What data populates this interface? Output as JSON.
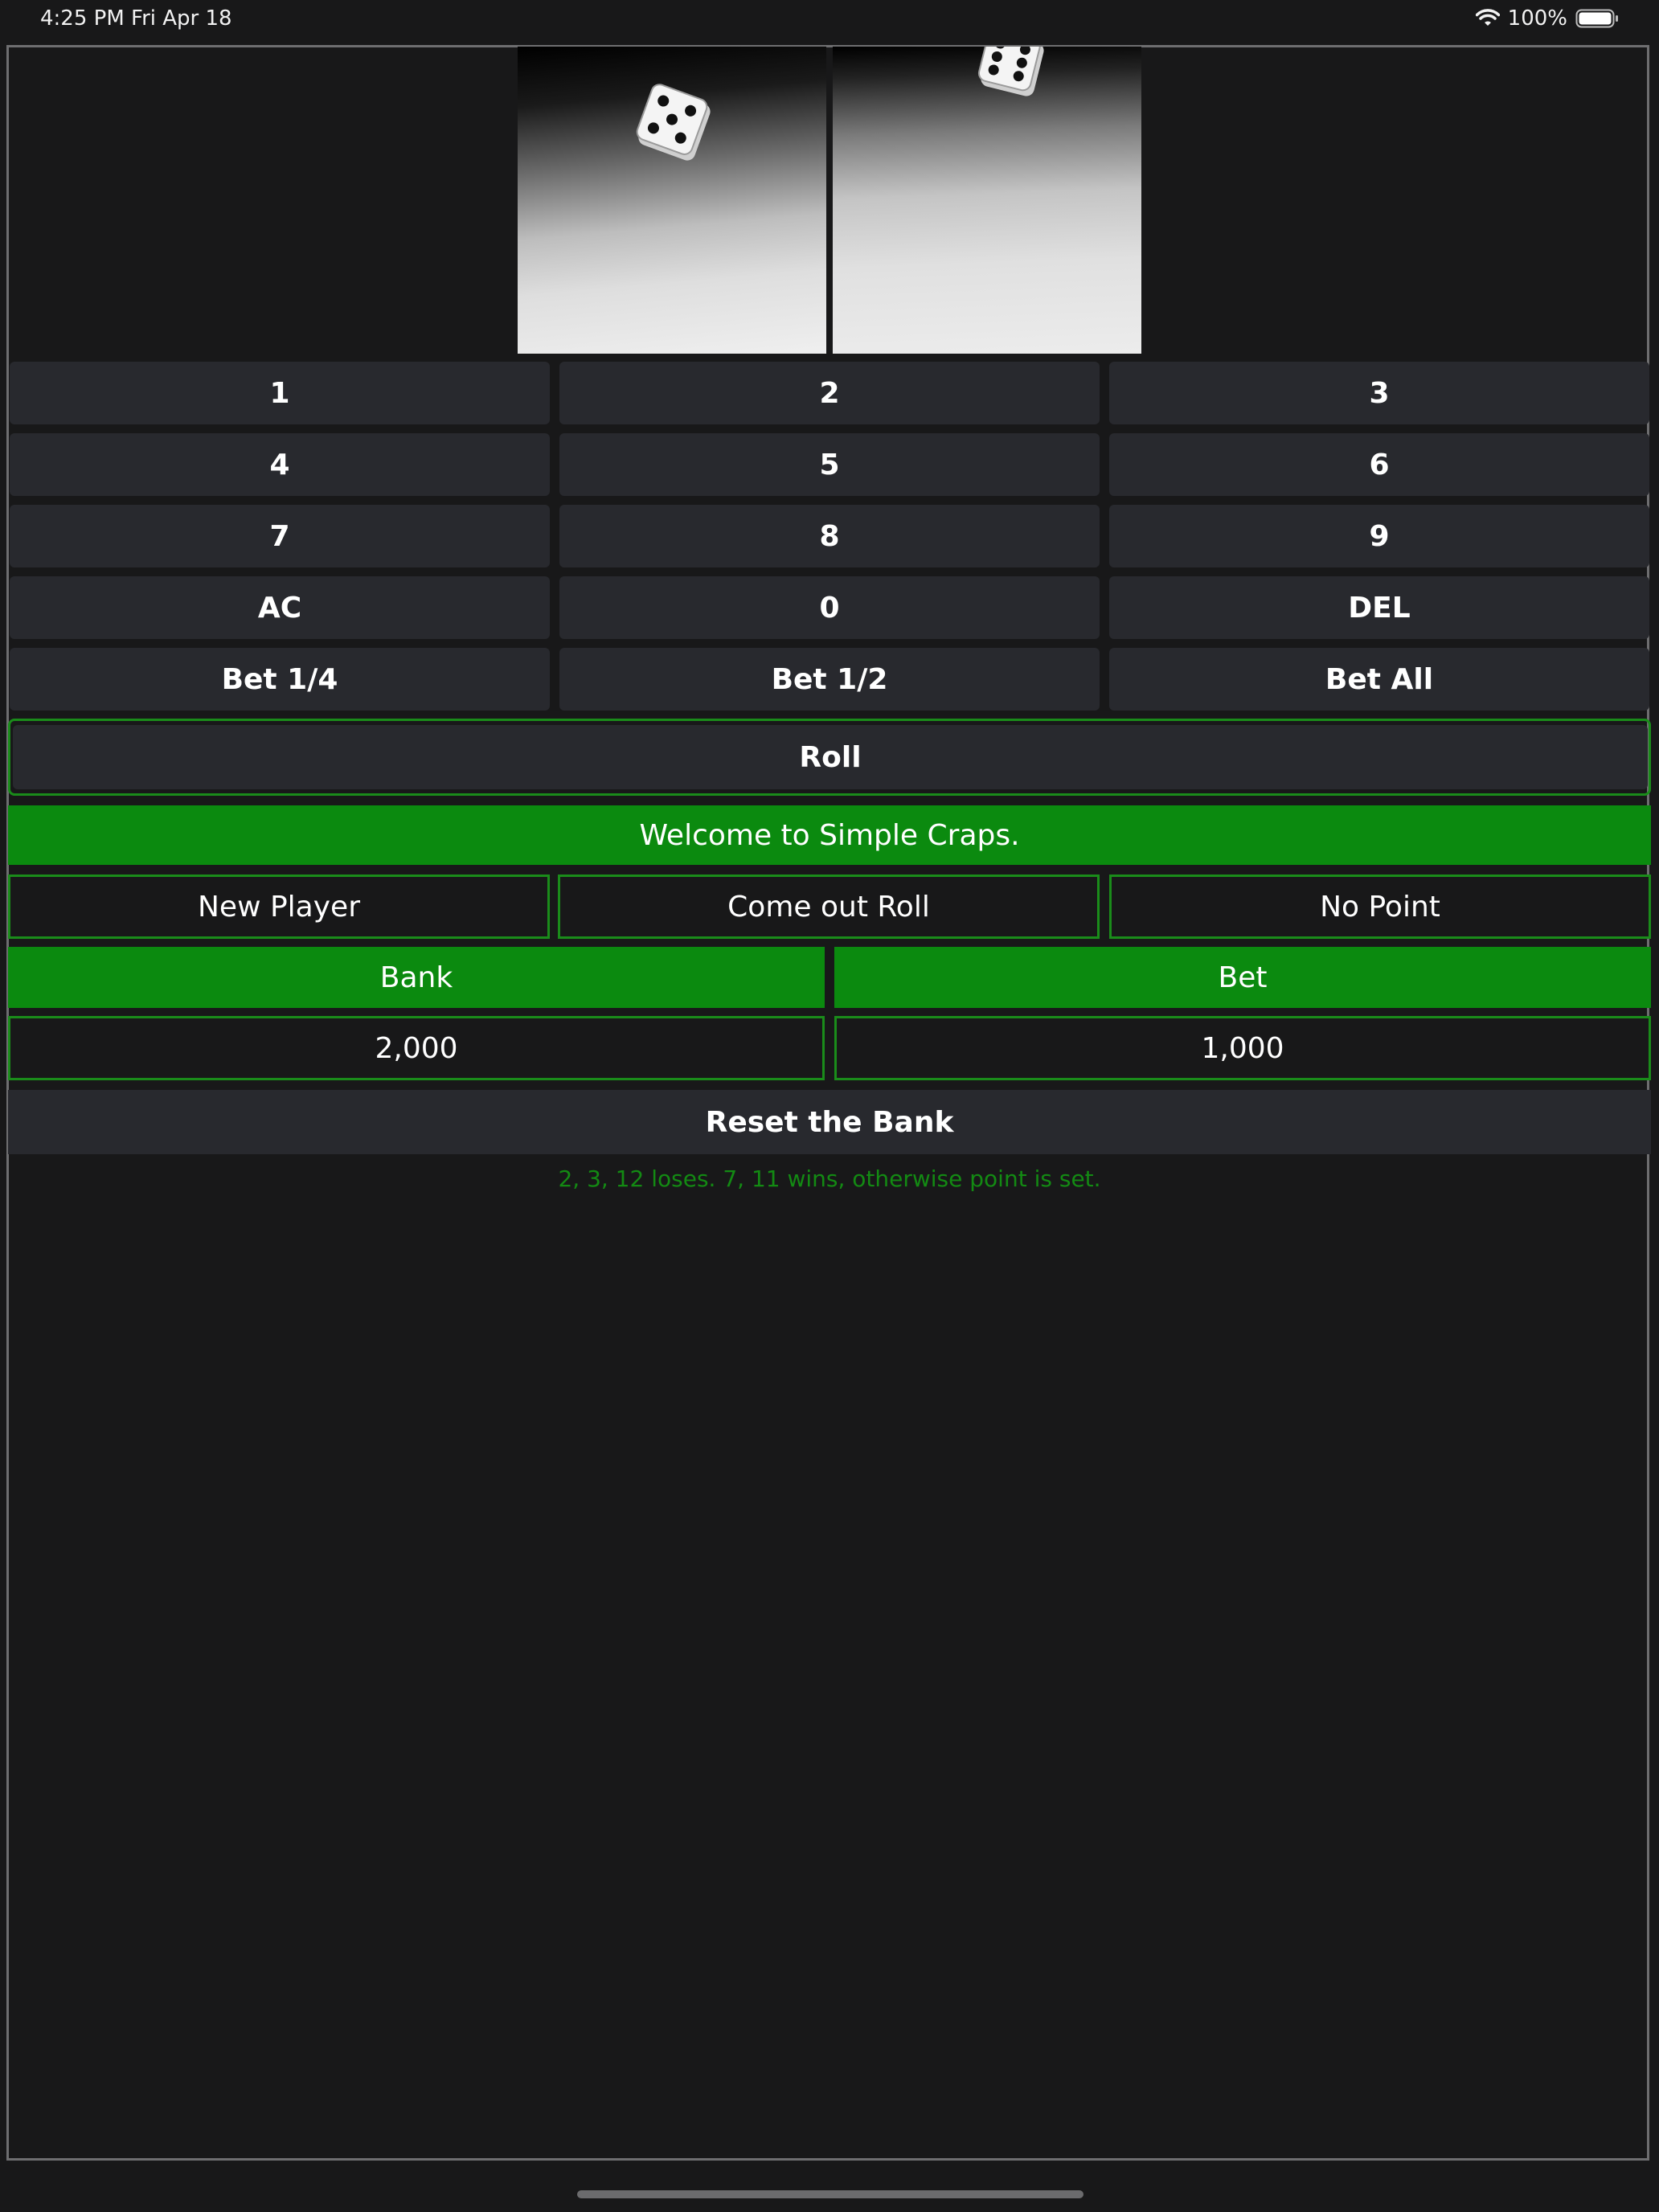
{
  "status_bar": {
    "time": "4:25 PM",
    "date": "Fri Apr 18",
    "battery": "100%",
    "icons": [
      "wifi-icon",
      "battery-icon"
    ]
  },
  "dice": {
    "left_die_face": 5,
    "right_die_face": 6
  },
  "keypad": {
    "keys": [
      "1",
      "2",
      "3",
      "4",
      "5",
      "6",
      "7",
      "8",
      "9",
      "AC",
      "0",
      "DEL"
    ],
    "bet_quarter": "Bet 1/4",
    "bet_half": "Bet 1/2",
    "bet_all": "Bet All"
  },
  "roll_label": "Roll",
  "message": "Welcome to Simple Craps.",
  "status": {
    "player": "New Player",
    "phase": "Come out Roll",
    "point": "No Point"
  },
  "labels": {
    "bank": "Bank",
    "bet": "Bet"
  },
  "values": {
    "bank": "2,000",
    "bet": "1,000"
  },
  "reset_label": "Reset the Bank",
  "hint": "2, 3, 12 loses. 7, 11 wins, otherwise point is set.",
  "colors": {
    "background": "#181819",
    "button": "#28292e",
    "accent_green": "#0b8a0f",
    "border_green": "#1a8c1a",
    "hint_green": "#138a13"
  }
}
